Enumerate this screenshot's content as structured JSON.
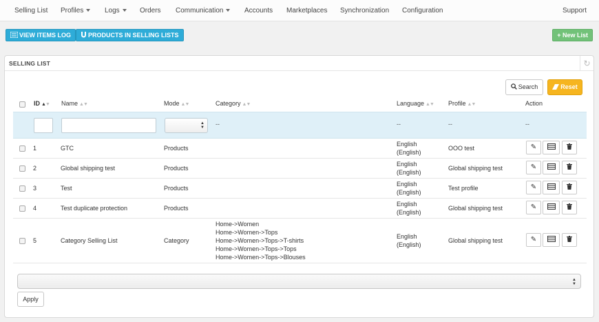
{
  "nav": {
    "items": [
      {
        "label": "Selling List"
      },
      {
        "label": "Profiles"
      },
      {
        "label": "Logs"
      },
      {
        "label": "Orders"
      },
      {
        "label": "Communication"
      },
      {
        "label": "Accounts"
      },
      {
        "label": "Marketplaces"
      },
      {
        "label": "Synchronization"
      },
      {
        "label": "Configuration"
      },
      {
        "label": "Support"
      }
    ]
  },
  "toolbar": {
    "view_log_label": "VIEW ITEMS LOG",
    "products_label": "PRODUCTS IN SELLING LISTS",
    "new_list_label": "+ New List"
  },
  "panel": {
    "title": "SELLING LIST",
    "search_label": "Search",
    "reset_label": "Reset"
  },
  "table": {
    "columns": [
      "ID",
      "Name",
      "Mode",
      "Category",
      "Language",
      "Profile",
      "Action"
    ],
    "filter_placeholders": {
      "category": "--",
      "language": "--",
      "profile": "--",
      "action": "--"
    },
    "rows": [
      {
        "id": "1",
        "name": "GTC",
        "mode": "Products",
        "category": [],
        "language": [
          "English",
          "(English)"
        ],
        "profile": "OOO test"
      },
      {
        "id": "2",
        "name": "Global shipping test",
        "mode": "Products",
        "category": [],
        "language": [
          "English",
          "(English)"
        ],
        "profile": "Global shipping test"
      },
      {
        "id": "3",
        "name": "Test",
        "mode": "Products",
        "category": [],
        "language": [
          "English",
          "(English)"
        ],
        "profile": "Test profile"
      },
      {
        "id": "4",
        "name": "Test duplicate protection",
        "mode": "Products",
        "category": [],
        "language": [
          "English",
          "(English)"
        ],
        "profile": "Global shipping test"
      },
      {
        "id": "5",
        "name": "Category Selling List",
        "mode": "Category",
        "category": [
          "Home->Women",
          "Home->Women->Tops",
          "Home->Women->Tops->T-shirts",
          "Home->Women->Tops->Tops",
          "Home->Women->Tops->Blouses"
        ],
        "language": [
          "English",
          "(English)"
        ],
        "profile": "Global shipping test"
      }
    ]
  },
  "bulk": {
    "selected": "",
    "apply_label": "Apply"
  },
  "colors": {
    "primary": "#2eacd8",
    "success": "#72c279",
    "warning": "#f6b51f",
    "filter_bg": "#dff0f8"
  }
}
